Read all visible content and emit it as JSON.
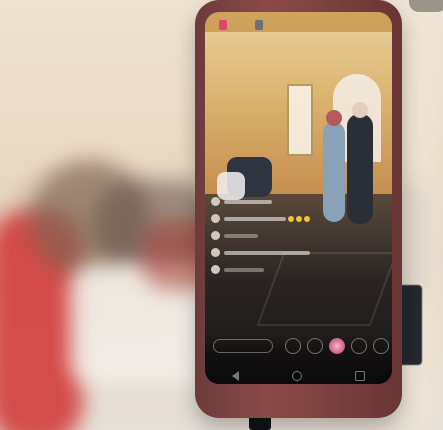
{
  "scene": {
    "description_ok": false
  },
  "overlay": {
    "live_badge": "",
    "viewer_badge": ""
  }
}
